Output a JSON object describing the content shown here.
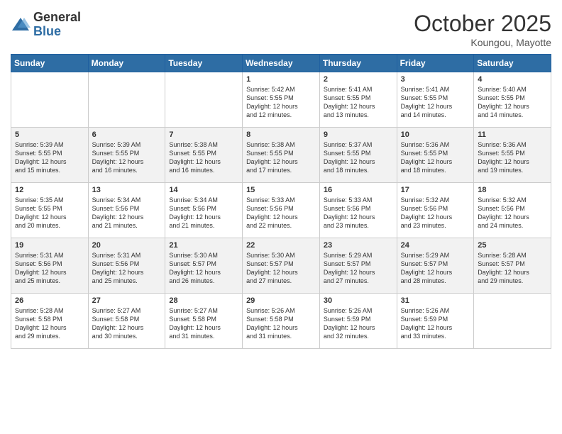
{
  "logo": {
    "general": "General",
    "blue": "Blue"
  },
  "header": {
    "month": "October 2025",
    "location": "Koungou, Mayotte"
  },
  "weekdays": [
    "Sunday",
    "Monday",
    "Tuesday",
    "Wednesday",
    "Thursday",
    "Friday",
    "Saturday"
  ],
  "weeks": [
    [
      {
        "day": "",
        "info": ""
      },
      {
        "day": "",
        "info": ""
      },
      {
        "day": "",
        "info": ""
      },
      {
        "day": "1",
        "info": "Sunrise: 5:42 AM\nSunset: 5:55 PM\nDaylight: 12 hours\nand 12 minutes."
      },
      {
        "day": "2",
        "info": "Sunrise: 5:41 AM\nSunset: 5:55 PM\nDaylight: 12 hours\nand 13 minutes."
      },
      {
        "day": "3",
        "info": "Sunrise: 5:41 AM\nSunset: 5:55 PM\nDaylight: 12 hours\nand 14 minutes."
      },
      {
        "day": "4",
        "info": "Sunrise: 5:40 AM\nSunset: 5:55 PM\nDaylight: 12 hours\nand 14 minutes."
      }
    ],
    [
      {
        "day": "5",
        "info": "Sunrise: 5:39 AM\nSunset: 5:55 PM\nDaylight: 12 hours\nand 15 minutes."
      },
      {
        "day": "6",
        "info": "Sunrise: 5:39 AM\nSunset: 5:55 PM\nDaylight: 12 hours\nand 16 minutes."
      },
      {
        "day": "7",
        "info": "Sunrise: 5:38 AM\nSunset: 5:55 PM\nDaylight: 12 hours\nand 16 minutes."
      },
      {
        "day": "8",
        "info": "Sunrise: 5:38 AM\nSunset: 5:55 PM\nDaylight: 12 hours\nand 17 minutes."
      },
      {
        "day": "9",
        "info": "Sunrise: 5:37 AM\nSunset: 5:55 PM\nDaylight: 12 hours\nand 18 minutes."
      },
      {
        "day": "10",
        "info": "Sunrise: 5:36 AM\nSunset: 5:55 PM\nDaylight: 12 hours\nand 18 minutes."
      },
      {
        "day": "11",
        "info": "Sunrise: 5:36 AM\nSunset: 5:55 PM\nDaylight: 12 hours\nand 19 minutes."
      }
    ],
    [
      {
        "day": "12",
        "info": "Sunrise: 5:35 AM\nSunset: 5:55 PM\nDaylight: 12 hours\nand 20 minutes."
      },
      {
        "day": "13",
        "info": "Sunrise: 5:34 AM\nSunset: 5:56 PM\nDaylight: 12 hours\nand 21 minutes."
      },
      {
        "day": "14",
        "info": "Sunrise: 5:34 AM\nSunset: 5:56 PM\nDaylight: 12 hours\nand 21 minutes."
      },
      {
        "day": "15",
        "info": "Sunrise: 5:33 AM\nSunset: 5:56 PM\nDaylight: 12 hours\nand 22 minutes."
      },
      {
        "day": "16",
        "info": "Sunrise: 5:33 AM\nSunset: 5:56 PM\nDaylight: 12 hours\nand 23 minutes."
      },
      {
        "day": "17",
        "info": "Sunrise: 5:32 AM\nSunset: 5:56 PM\nDaylight: 12 hours\nand 23 minutes."
      },
      {
        "day": "18",
        "info": "Sunrise: 5:32 AM\nSunset: 5:56 PM\nDaylight: 12 hours\nand 24 minutes."
      }
    ],
    [
      {
        "day": "19",
        "info": "Sunrise: 5:31 AM\nSunset: 5:56 PM\nDaylight: 12 hours\nand 25 minutes."
      },
      {
        "day": "20",
        "info": "Sunrise: 5:31 AM\nSunset: 5:56 PM\nDaylight: 12 hours\nand 25 minutes."
      },
      {
        "day": "21",
        "info": "Sunrise: 5:30 AM\nSunset: 5:57 PM\nDaylight: 12 hours\nand 26 minutes."
      },
      {
        "day": "22",
        "info": "Sunrise: 5:30 AM\nSunset: 5:57 PM\nDaylight: 12 hours\nand 27 minutes."
      },
      {
        "day": "23",
        "info": "Sunrise: 5:29 AM\nSunset: 5:57 PM\nDaylight: 12 hours\nand 27 minutes."
      },
      {
        "day": "24",
        "info": "Sunrise: 5:29 AM\nSunset: 5:57 PM\nDaylight: 12 hours\nand 28 minutes."
      },
      {
        "day": "25",
        "info": "Sunrise: 5:28 AM\nSunset: 5:57 PM\nDaylight: 12 hours\nand 29 minutes."
      }
    ],
    [
      {
        "day": "26",
        "info": "Sunrise: 5:28 AM\nSunset: 5:58 PM\nDaylight: 12 hours\nand 29 minutes."
      },
      {
        "day": "27",
        "info": "Sunrise: 5:27 AM\nSunset: 5:58 PM\nDaylight: 12 hours\nand 30 minutes."
      },
      {
        "day": "28",
        "info": "Sunrise: 5:27 AM\nSunset: 5:58 PM\nDaylight: 12 hours\nand 31 minutes."
      },
      {
        "day": "29",
        "info": "Sunrise: 5:26 AM\nSunset: 5:58 PM\nDaylight: 12 hours\nand 31 minutes."
      },
      {
        "day": "30",
        "info": "Sunrise: 5:26 AM\nSunset: 5:59 PM\nDaylight: 12 hours\nand 32 minutes."
      },
      {
        "day": "31",
        "info": "Sunrise: 5:26 AM\nSunset: 5:59 PM\nDaylight: 12 hours\nand 33 minutes."
      },
      {
        "day": "",
        "info": ""
      }
    ]
  ]
}
